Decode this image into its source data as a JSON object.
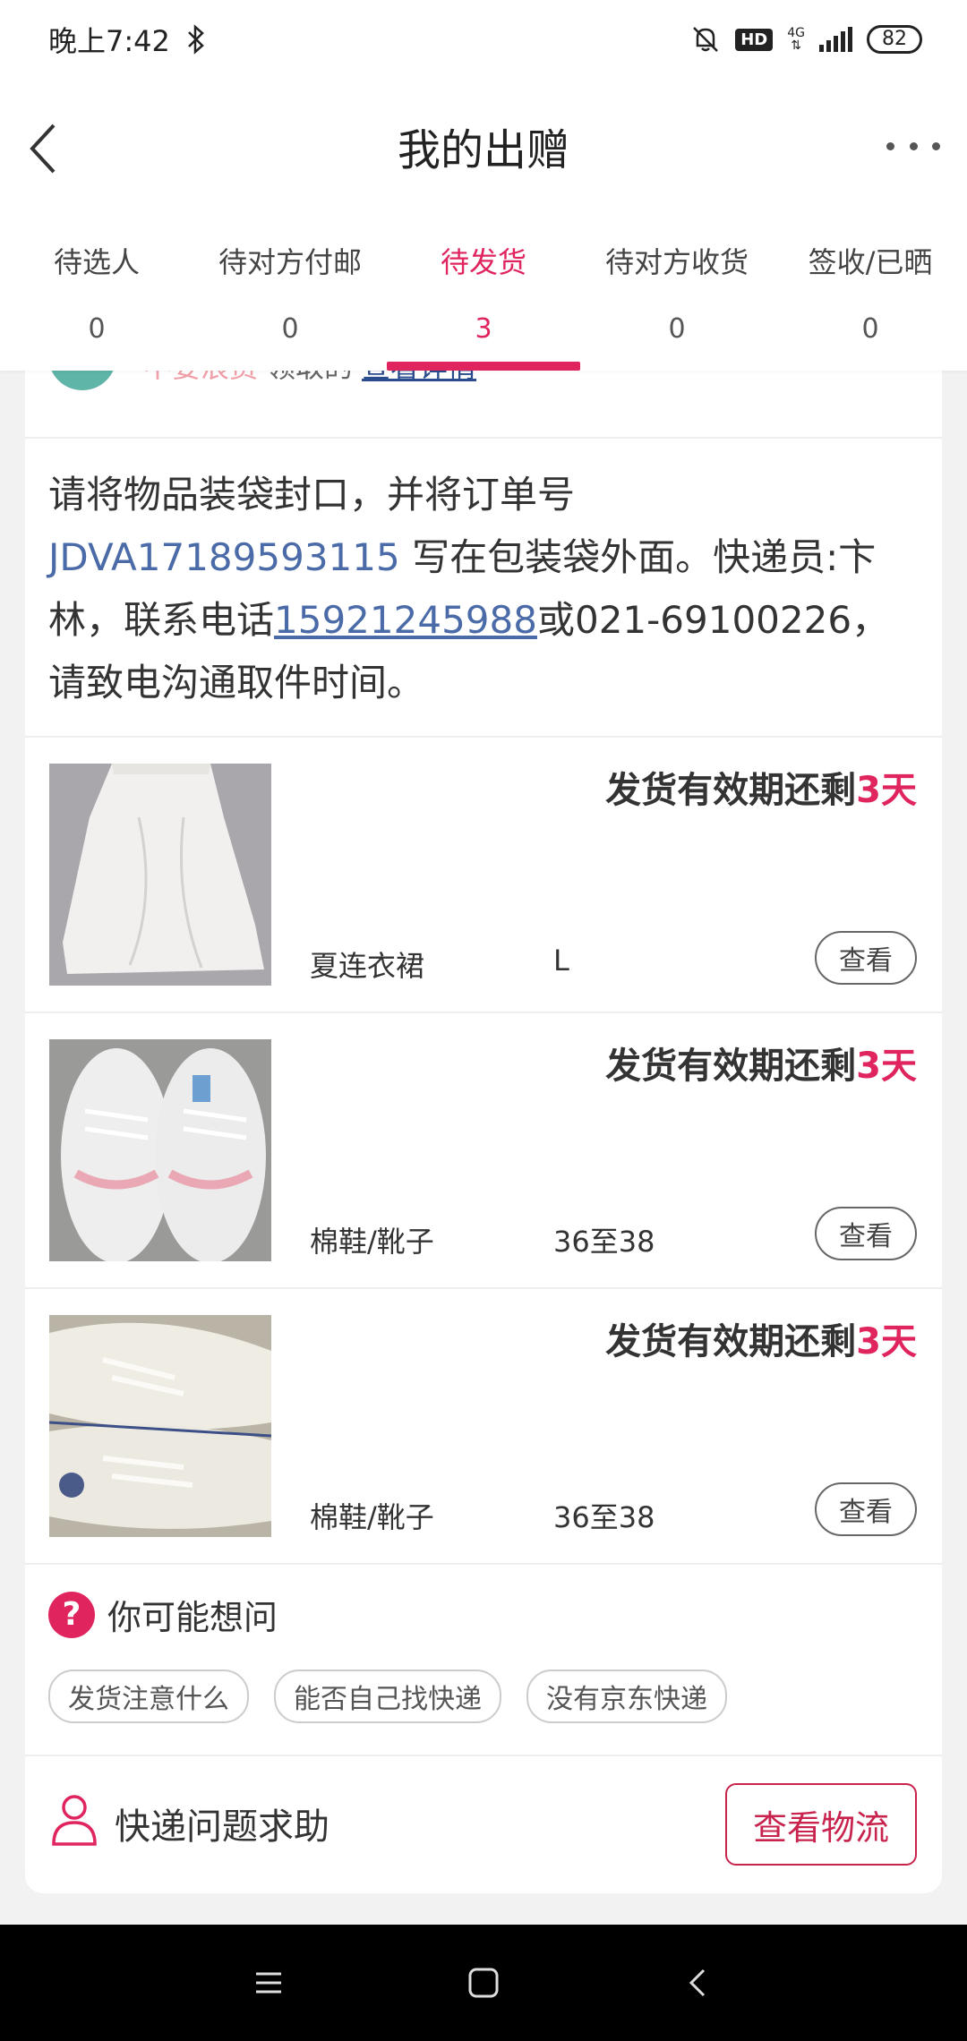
{
  "status_bar": {
    "time": "晚上7:42",
    "network": "4G",
    "hd": "HD",
    "battery": "82"
  },
  "header": {
    "title": "我的出赠"
  },
  "tabs": [
    {
      "label": "待选人",
      "count": "0"
    },
    {
      "label": "待对方付邮",
      "count": "0"
    },
    {
      "label": "待发货",
      "count": "3",
      "active": true
    },
    {
      "label": "待对方收货",
      "count": "0"
    },
    {
      "label": "签收/已晒",
      "count": "0"
    }
  ],
  "donor": {
    "name": "不要浪费",
    "action": "领取的",
    "link": "查看详情"
  },
  "notice": {
    "part1": "请将物品装袋封口，并将订单号 ",
    "order_no": "JDVA17189593115",
    "part2": " 写在包装袋外面。快递员:卞林，联系电话",
    "phone": "15921245988",
    "part3": "或021-69100226，请致电沟通取件时间。"
  },
  "items": [
    {
      "deadline_prefix": "发货有效期还剩",
      "deadline_days": "3天",
      "name": "夏连衣裙",
      "size": "L",
      "view_label": "查看"
    },
    {
      "deadline_prefix": "发货有效期还剩",
      "deadline_days": "3天",
      "name": "棉鞋/靴子",
      "size": "36至38",
      "view_label": "查看"
    },
    {
      "deadline_prefix": "发货有效期还剩",
      "deadline_days": "3天",
      "name": "棉鞋/靴子",
      "size": "36至38",
      "view_label": "查看"
    }
  ],
  "faq": {
    "title": "你可能想问",
    "chips": [
      "发货注意什么",
      "能否自己找快递",
      "没有京东快递"
    ]
  },
  "help": {
    "label": "快递问题求助",
    "button": "查看物流"
  },
  "colors": {
    "accent": "#e0245e",
    "link": "#4a6aa8"
  }
}
